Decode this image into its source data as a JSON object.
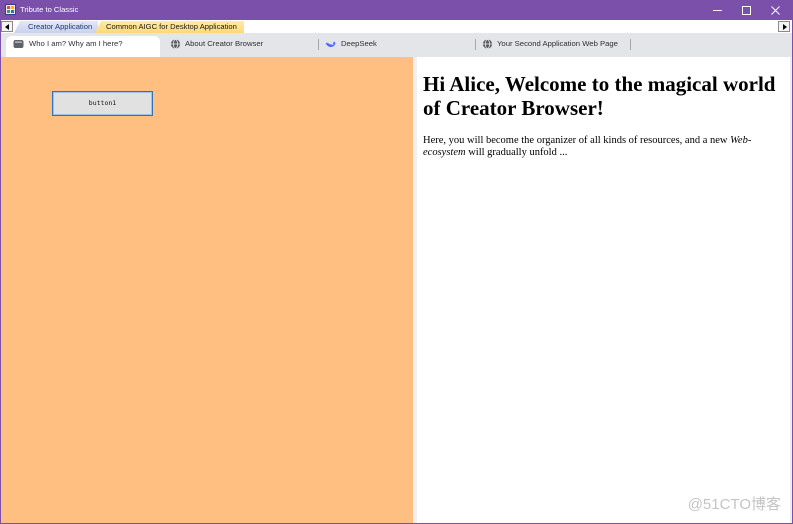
{
  "window": {
    "title": "Tribute to Classic",
    "accent_color": "#7A50AB",
    "icon": "app-icon",
    "controls": [
      {
        "name": "minimize",
        "icon": "minimize-icon"
      },
      {
        "name": "maximize",
        "icon": "maximize-icon"
      },
      {
        "name": "close",
        "icon": "close-icon"
      }
    ]
  },
  "app_tabs": {
    "scroll_left_icon": "arrow-left-icon",
    "scroll_right_icon": "arrow-right-icon",
    "items": [
      {
        "label": "Creator Application",
        "selected": false,
        "color": "#D3DAF2"
      },
      {
        "label": "Common AIGC for Desktop Application",
        "selected": true,
        "color": "#FFE28F"
      }
    ]
  },
  "browser_tabs": [
    {
      "label": "Who I am? Why am I here?",
      "icon": "document-icon",
      "selected": true
    },
    {
      "label": "About Creator Browser",
      "icon": "globe-icon",
      "selected": false
    },
    {
      "label": "DeepSeek",
      "icon": "deepseek-whale-icon",
      "selected": false,
      "icon_color": "#4D6BFE"
    },
    {
      "label": "Your Second Application Web Page",
      "icon": "globe-icon",
      "selected": false
    }
  ],
  "left_panel": {
    "background": "#FFBF80",
    "button_label": "button1"
  },
  "web_page": {
    "heading": "Hi Alice, Welcome to the magical world of Creator Browser!",
    "intro_before": "Here, you will become the organizer of all kinds of resources, and a new ",
    "intro_emphasis": "Web-ecosystem",
    "intro_after": " will gradually unfold ..."
  },
  "watermark": "@51CTO博客"
}
